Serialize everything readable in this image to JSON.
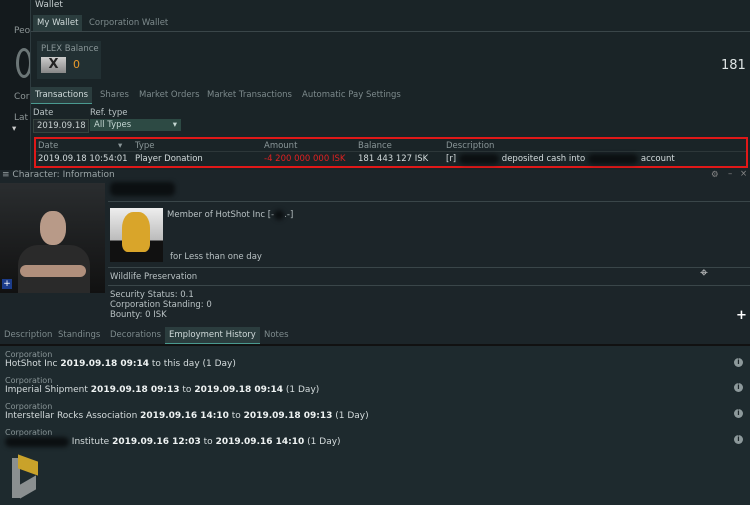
{
  "background": {
    "labels": [
      "Peo",
      "Cor",
      "Lat"
    ]
  },
  "wallet": {
    "title": "Wallet",
    "tabs": [
      {
        "label": "My Wallet",
        "selected": true
      },
      {
        "label": "Corporation Wallet",
        "selected": false
      }
    ],
    "plex": {
      "label": "PLEX Balance",
      "value": "0"
    },
    "right_value": "181",
    "subtabs": [
      {
        "label": "Transactions",
        "selected": true
      },
      {
        "label": "Shares"
      },
      {
        "label": "Market Orders"
      },
      {
        "label": "Market Transactions"
      },
      {
        "label": "Automatic Pay Settings"
      }
    ],
    "filters": {
      "date_label": "Date",
      "date_value": "2019.09.18",
      "ref_label": "Ref. type",
      "ref_value": "All Types"
    },
    "table": {
      "columns": [
        "Date",
        "Type",
        "Amount",
        "Balance",
        "Description"
      ],
      "rows": [
        {
          "date": "2019.09.18 10:54:01",
          "type": "Player Donation",
          "amount": "-4 200 000 000 ISK",
          "balance": "181 443 127 ISK",
          "desc_prefix": "[r]",
          "desc_mid": "deposited cash into",
          "desc_suffix": "account"
        }
      ]
    },
    "highlight_color": "#e01818",
    "negative_color": "#e02020"
  },
  "character": {
    "title": "Character: Information",
    "member_of": "Member of HotShot Inc [-",
    "member_suffix": ".-]",
    "duration": "for Less than one day",
    "faction": "Wildlife Preservation",
    "security": "Security Status: 0.1",
    "standing": "Corporation Standing: 0",
    "bounty": "Bounty: 0 ISK",
    "tabs": [
      {
        "label": "Description"
      },
      {
        "label": "Standings"
      },
      {
        "label": "Decorations"
      },
      {
        "label": "Employment History",
        "selected": true
      },
      {
        "label": "Notes"
      }
    ],
    "history": [
      {
        "label": "Corporation",
        "name": "HotShot Inc",
        "from": "2019.09.18 09:14",
        "sep": "to this day",
        "to": "",
        "days": "(1 Day)"
      },
      {
        "label": "Corporation",
        "name": "Imperial Shipment",
        "from": "2019.09.18 09:13",
        "sep": "to",
        "to": "2019.09.18 09:14",
        "days": "(1 Day)"
      },
      {
        "label": "Corporation",
        "name": "Interstellar Rocks Association",
        "from": "2019.09.16 14:10",
        "sep": "to",
        "to": "2019.09.18 09:13",
        "days": "(1 Day)"
      },
      {
        "label": "Corporation",
        "name": "Institute",
        "from": "2019.09.16 12:03",
        "sep": "to",
        "to": "2019.09.16 14:10",
        "days": "(1 Day)"
      }
    ]
  }
}
